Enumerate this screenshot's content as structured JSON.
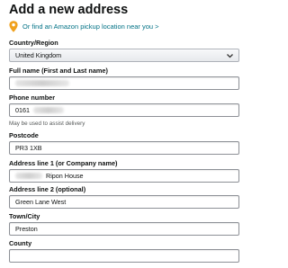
{
  "page": {
    "title": "Add a new address",
    "pickup_link": "Or find an Amazon pickup location near you >"
  },
  "form": {
    "country": {
      "label": "Country/Region",
      "value": "United Kingdom"
    },
    "full_name": {
      "label": "Full name (First and Last name)",
      "value": ""
    },
    "phone": {
      "label": "Phone number",
      "value": "0161",
      "hint": "May be used to assist delivery"
    },
    "postcode": {
      "label": "Postcode",
      "value": "PR3 1XB"
    },
    "address1": {
      "label": "Address line 1 (or Company name)",
      "value": "Ripon House"
    },
    "address2": {
      "label": "Address line 2 (optional)",
      "value": "Green Lane West"
    },
    "town": {
      "label": "Town/City",
      "value": "Preston"
    },
    "county": {
      "label": "County",
      "value": ""
    }
  },
  "colors": {
    "link": "#007185",
    "pin": "#f0a11e",
    "border": "#8d9096"
  },
  "icons": {
    "pickup": "location-pin-icon",
    "dropdown": "chevron-down-icon"
  }
}
